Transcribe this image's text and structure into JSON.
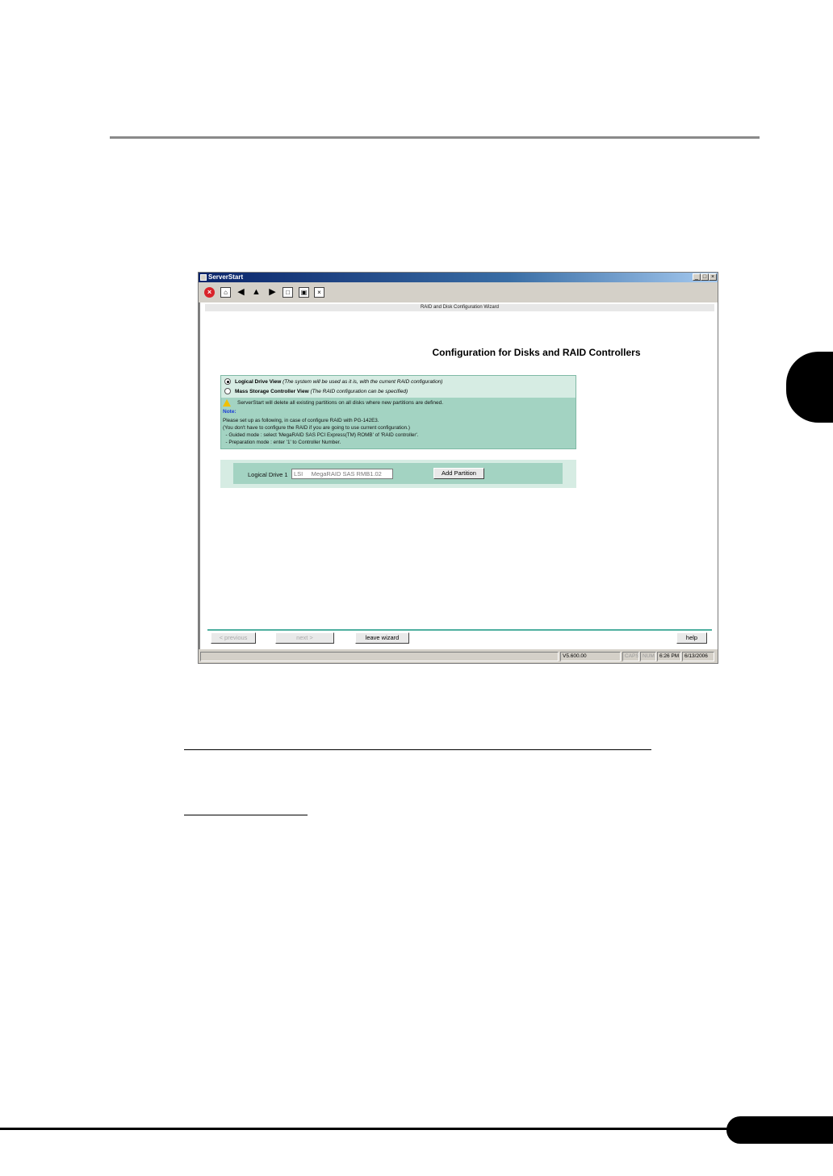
{
  "window": {
    "title": "ServerStart",
    "caption_buttons": [
      "_",
      "□",
      "×"
    ]
  },
  "toolbar": {
    "icons": [
      "stop-icon",
      "home-icon",
      "back-icon",
      "up-icon",
      "forward-icon",
      "page-icon",
      "window-icon",
      "close-doc-icon"
    ]
  },
  "wizard": {
    "bar_label": "RAID and Disk Configuration Wizard",
    "heading": "Configuration for Disks and RAID Controllers",
    "options": [
      {
        "label": "Logical Drive View",
        "desc": "(The system will be used as it is, with the current RAID configuration)",
        "selected": true
      },
      {
        "label": "Mass Storage Controller View",
        "desc": "(The RAID configuration can be specified)",
        "selected": false
      }
    ],
    "warning": "ServerStart will delete all existing partitions on all disks where new partitions are defined.",
    "note_label": "Note:",
    "note_lines": [
      "Please set up as following, in case of configure RAID with PG-142E3.",
      "(You don't have to configure the RAID if you are going to use current configuration.)",
      "  - Guided mode : select 'MegaRAID SAS PCI Express(TM) ROMB' of 'RAID controller'.",
      "  - Preparation mode : enter '1' to Controller Number."
    ],
    "drive": {
      "label": "Logical Drive 1",
      "value": "LSI     MegaRAID SAS RMB1.02",
      "add_partition": "Add Partition"
    },
    "buttons": {
      "previous": "< previous",
      "next": "next >",
      "leave": "leave wizard",
      "help": "help"
    }
  },
  "statusbar": {
    "version": "V5.600.00",
    "caps": "CAPS",
    "num": "NUM",
    "time": "6:26 PM",
    "date": "6/13/2006"
  },
  "colors": {
    "panel_dark": "#a3d3c2",
    "panel_light": "#d6ece3",
    "accent_line": "#4fb0a0"
  }
}
